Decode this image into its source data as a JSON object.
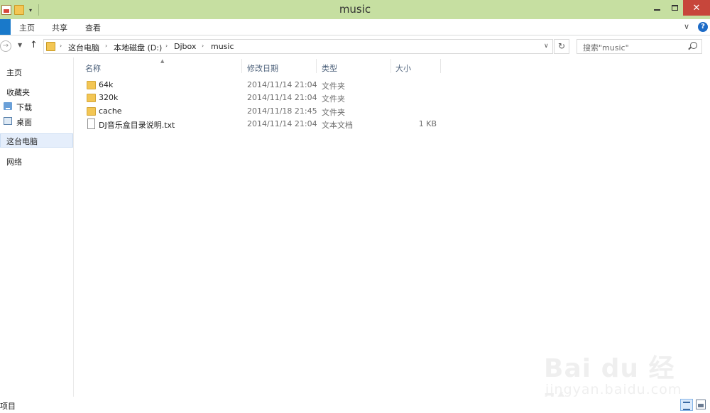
{
  "window": {
    "title": "music"
  },
  "ribbon": {
    "tabs": [
      {
        "label": "主页"
      },
      {
        "label": "共享"
      },
      {
        "label": "查看"
      }
    ],
    "help": "?"
  },
  "address": {
    "crumbs": [
      "这台电脑",
      "本地磁盘 (D:)",
      "Djbox",
      "music"
    ]
  },
  "search": {
    "placeholder": "搜索\"music\""
  },
  "navpane": {
    "items": [
      {
        "label": "主页",
        "icon": "home-icon"
      },
      {
        "label": "收藏夹",
        "icon": "star-icon"
      },
      {
        "label": "下载",
        "icon": "download-folder-icon"
      },
      {
        "label": "桌面",
        "icon": "desktop-icon"
      },
      {
        "label": "这台电脑",
        "icon": "computer-icon",
        "selected": true
      },
      {
        "label": "网络",
        "icon": "network-icon"
      }
    ]
  },
  "columns": {
    "name": "名称",
    "date": "修改日期",
    "type": "类型",
    "size": "大小"
  },
  "files": [
    {
      "name": "64k",
      "date": "2014/11/14 21:04",
      "type": "文件夹",
      "size": "",
      "icon": "folder-icon"
    },
    {
      "name": "320k",
      "date": "2014/11/14 21:04",
      "type": "文件夹",
      "size": "",
      "icon": "folder-icon"
    },
    {
      "name": "cache",
      "date": "2014/11/18 21:45",
      "type": "文件夹",
      "size": "",
      "icon": "folder-icon"
    },
    {
      "name": "DJ音乐盒目录说明.txt",
      "date": "2014/11/14 21:04",
      "type": "文本文档",
      "size": "1 KB",
      "icon": "text-file-icon"
    }
  ],
  "status": {
    "text": "项目"
  },
  "watermark": {
    "brand": "Bai du 经验",
    "url": "jingyan.baidu.com"
  }
}
